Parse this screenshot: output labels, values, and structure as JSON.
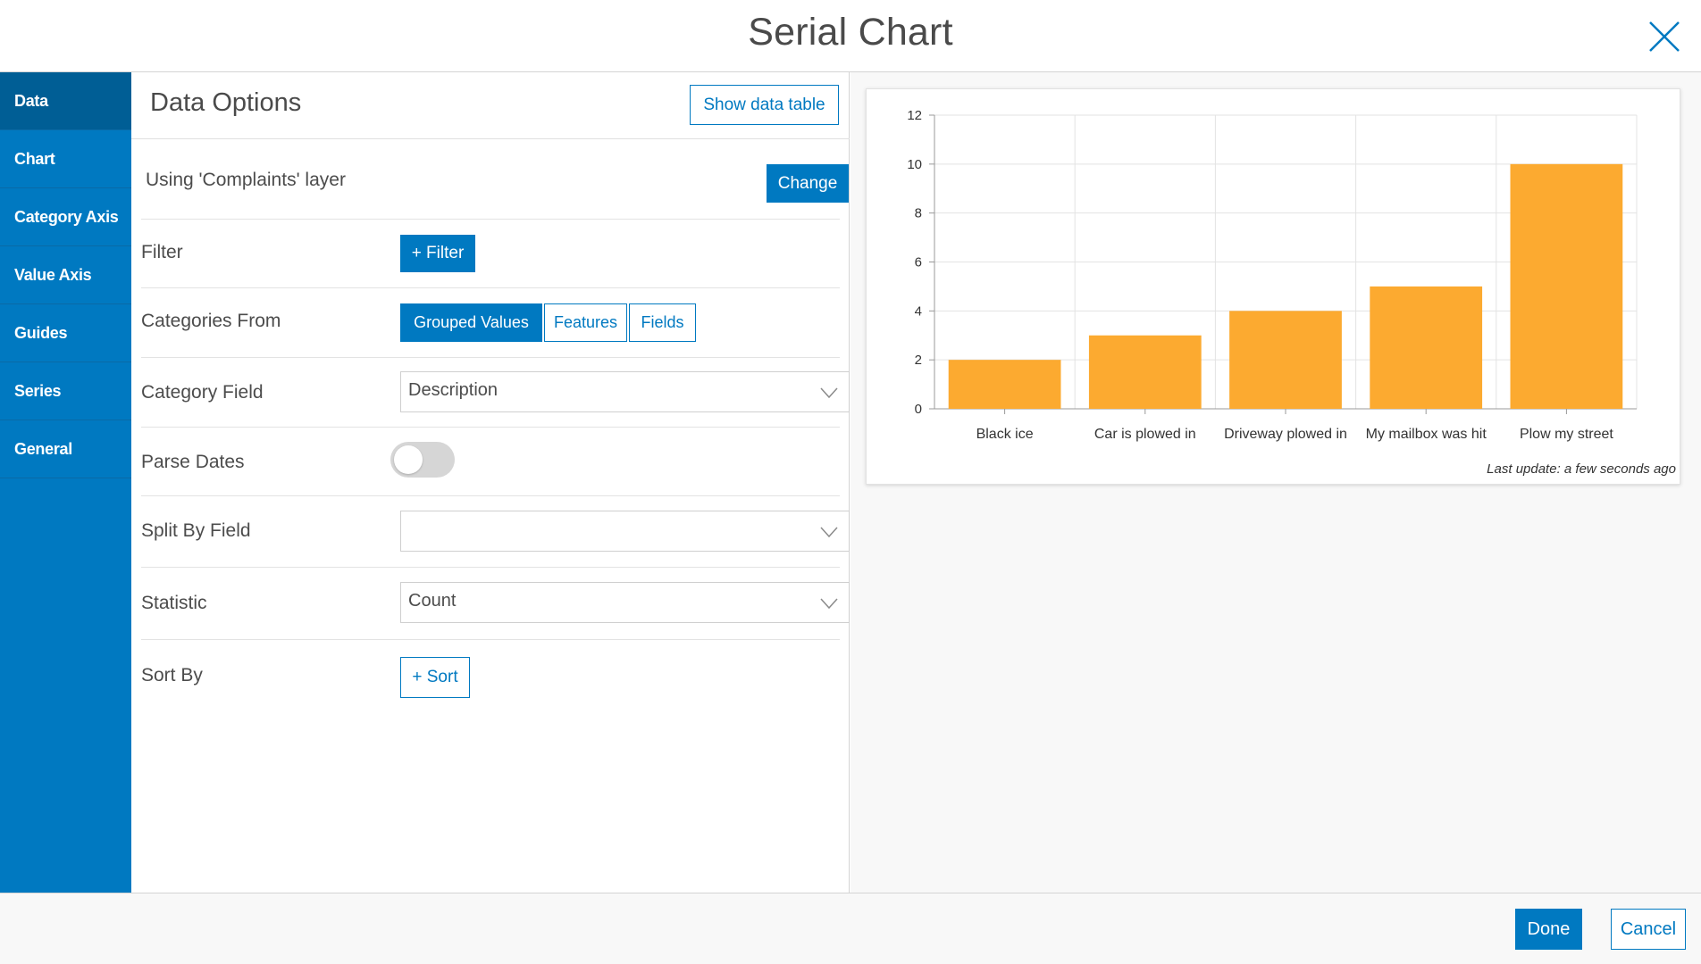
{
  "dialog": {
    "title": "Serial Chart"
  },
  "sidebar": {
    "items": [
      {
        "label": "Data",
        "active": true
      },
      {
        "label": "Chart"
      },
      {
        "label": "Category Axis"
      },
      {
        "label": "Value Axis"
      },
      {
        "label": "Guides"
      },
      {
        "label": "Series"
      },
      {
        "label": "General"
      }
    ]
  },
  "options": {
    "title": "Data Options",
    "show_table_label": "Show data table",
    "layer_text": "Using 'Complaints' layer",
    "change_label": "Change",
    "filter": {
      "label": "Filter",
      "button": "+ Filter"
    },
    "categories_from": {
      "label": "Categories From",
      "options": [
        "Grouped Values",
        "Features",
        "Fields"
      ],
      "selected": "Grouped Values"
    },
    "category_field": {
      "label": "Category Field",
      "value": "Description"
    },
    "parse_dates": {
      "label": "Parse Dates",
      "on": false
    },
    "split_by": {
      "label": "Split By Field",
      "value": ""
    },
    "statistic": {
      "label": "Statistic",
      "value": "Count"
    },
    "sort_by": {
      "label": "Sort By",
      "button": "+ Sort"
    }
  },
  "chart_data": {
    "type": "bar",
    "categories": [
      "Black ice",
      "Car is plowed in",
      "Driveway plowed in",
      "My mailbox was hit",
      "Plow my street"
    ],
    "values": [
      2,
      3,
      4,
      5,
      10
    ],
    "ylim": [
      0,
      12
    ],
    "yticks": [
      0,
      2,
      4,
      6,
      8,
      10,
      12
    ],
    "bar_color": "#fcaa30",
    "grid": true,
    "footer_note": "Last update: a few seconds ago"
  },
  "footer": {
    "done_label": "Done",
    "cancel_label": "Cancel"
  },
  "colors": {
    "accent": "#0079c1",
    "accent_dark": "#005e95",
    "bar": "#fcaa30"
  }
}
